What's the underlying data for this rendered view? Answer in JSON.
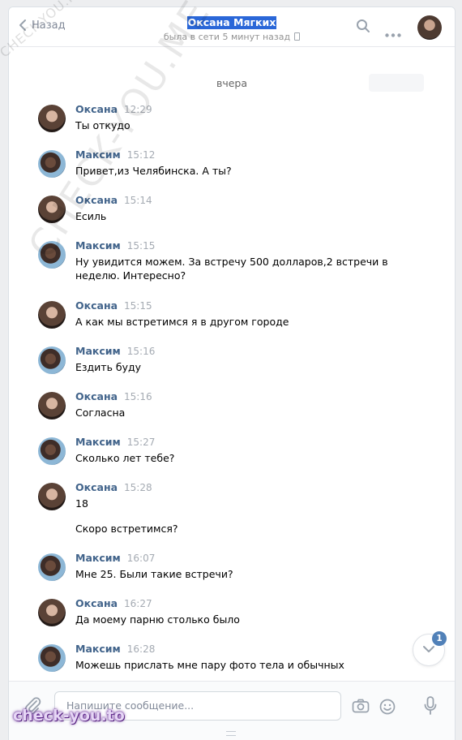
{
  "header": {
    "back_label": "Назад",
    "title": "Оксана Мягких",
    "status": "была в сети 5 минут назад"
  },
  "date_separator": "вчера",
  "messages": [
    {
      "author": "Оксана",
      "time": "12:29",
      "lines": [
        "Ты откудо"
      ]
    },
    {
      "author": "Максим",
      "time": "15:12",
      "lines": [
        "Привет,из Челябинска. А ты?"
      ]
    },
    {
      "author": "Оксана",
      "time": "15:14",
      "lines": [
        "Есиль"
      ]
    },
    {
      "author": "Максим",
      "time": "15:15",
      "lines": [
        "Ну увидится можем. За встречу 500 долларов,2 встречи в",
        "неделю. Интересно?"
      ]
    },
    {
      "author": "Оксана",
      "time": "15:15",
      "lines": [
        "А как мы встретимся я в другом городе"
      ]
    },
    {
      "author": "Максим",
      "time": "15:16",
      "lines": [
        "Ездить буду"
      ]
    },
    {
      "author": "Оксана",
      "time": "15:16",
      "lines": [
        "Согласна"
      ]
    },
    {
      "author": "Максим",
      "time": "15:27",
      "lines": [
        "Сколько лет тебе?"
      ]
    },
    {
      "author": "Оксана",
      "time": "15:28",
      "lines": [
        "18"
      ],
      "extra": "Скоро встретимся?"
    },
    {
      "author": "Максим",
      "time": "16:07",
      "lines": [
        "Мне 25. Были такие встречи?"
      ]
    },
    {
      "author": "Оксана",
      "time": "16:27",
      "lines": [
        "Да моему парню столько было"
      ]
    },
    {
      "author": "Максим",
      "time": "16:28",
      "lines": [
        "Можешь прислать мне пару фото тела и обычных"
      ]
    }
  ],
  "unread_badge": "1",
  "composer": {
    "placeholder": "Напишите сообщение..."
  },
  "watermarks": {
    "top": "CHECK-YOU.ME",
    "diagonal": "CHECK-YOU.ME",
    "bottom": "check-you.to"
  },
  "colors": {
    "accent": "#5181b8",
    "name": "#42648b",
    "highlight": "#2a67d8"
  }
}
